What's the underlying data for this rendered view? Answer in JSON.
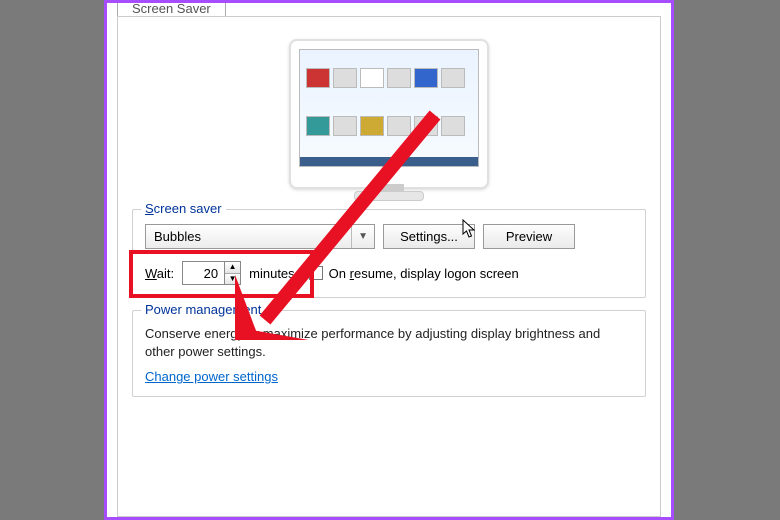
{
  "tab": {
    "label": "Screen Saver"
  },
  "screensaver": {
    "group_label_prefix": "S",
    "group_label_rest": "creen saver",
    "combo_value": "Bubbles",
    "settings_button": "Settings...",
    "preview_button": "Preview",
    "wait_label_prefix": "W",
    "wait_label_rest": "ait:",
    "wait_value": "20",
    "wait_units": "minutes",
    "resume_prefix": "On ",
    "resume_ul": "r",
    "resume_rest": "esume, display logon screen",
    "resume_checked": false
  },
  "power": {
    "group_label": "Power management",
    "text": "Conserve energy or maximize performance by adjusting display brightness and other power settings.",
    "link": "Change power settings"
  }
}
